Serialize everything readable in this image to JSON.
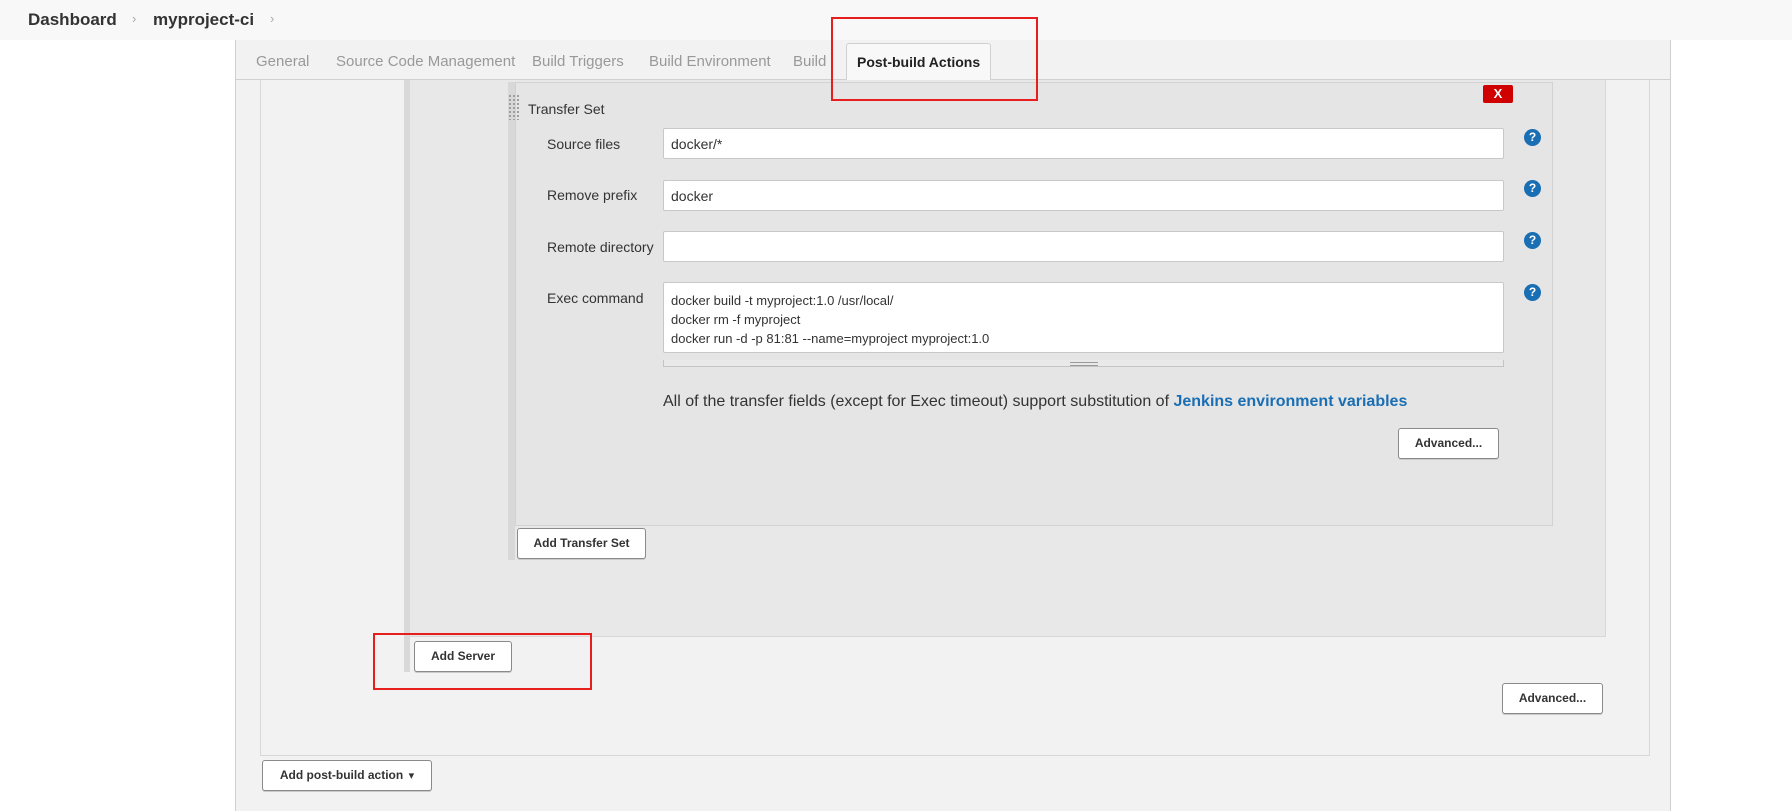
{
  "breadcrumb": {
    "items": [
      "Dashboard",
      "myproject-ci"
    ]
  },
  "tabs": [
    {
      "label": "General"
    },
    {
      "label": "Source Code Management"
    },
    {
      "label": "Build Triggers"
    },
    {
      "label": "Build Environment"
    },
    {
      "label": "Build"
    },
    {
      "label": "Post-build Actions",
      "active": true
    }
  ],
  "transfer_set": {
    "title": "Transfer Set",
    "delete_label": "X",
    "source_files": {
      "label": "Source files",
      "value": "docker/*"
    },
    "remove_prefix": {
      "label": "Remove prefix",
      "value": "docker"
    },
    "remote_directory": {
      "label": "Remote directory",
      "value": ""
    },
    "exec_command": {
      "label": "Exec command",
      "value": "docker build -t myproject:1.0 /usr/local/\ndocker rm -f myproject\ndocker run -d -p 81:81 --name=myproject myproject:1.0"
    },
    "help_icon": "?",
    "note_text": "All of the transfer fields (except for Exec timeout) support substitution of ",
    "note_link": "Jenkins environment variables",
    "advanced_label": "Advanced..."
  },
  "buttons": {
    "add_transfer_set": "Add Transfer Set",
    "add_server": "Add Server",
    "server_advanced": "Advanced...",
    "add_post_build_action": "Add post-build action",
    "add_post_build_action_caret": "▾"
  },
  "highlight_color": "#e61e1e"
}
